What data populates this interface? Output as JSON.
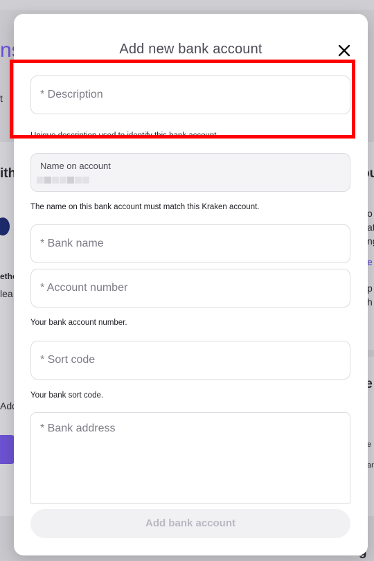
{
  "background": {
    "fragments": {
      "title": "ns",
      "t": "t",
      "ith": "ith",
      "ou": "ou",
      "o": "o",
      "at": "at",
      "ng": "ng",
      "e": "e",
      "p": "p",
      "h": "h",
      "etho": "etho",
      "lea": "lea",
      "le": "le",
      "add": "Add",
      "e2": "e",
      "an": "an",
      "g": "g"
    }
  },
  "modal": {
    "title": "Add new bank account",
    "close_icon": "close-icon",
    "description": {
      "placeholder": "* Description",
      "hint": "Unique description used to identify this bank account"
    },
    "name_on_account": {
      "label": "Name on account",
      "hint": "The name on this bank account must match this Kraken account."
    },
    "bank_name": {
      "placeholder": "* Bank name"
    },
    "account_number": {
      "placeholder": "* Account number",
      "hint": "Your bank account number."
    },
    "sort_code": {
      "placeholder": "* Sort code",
      "hint": "Your bank sort code."
    },
    "bank_address": {
      "placeholder": "* Bank address"
    },
    "submit_label": "Add bank account"
  },
  "colors": {
    "highlight": "#ff0000",
    "accent": "#5a3bd1"
  }
}
